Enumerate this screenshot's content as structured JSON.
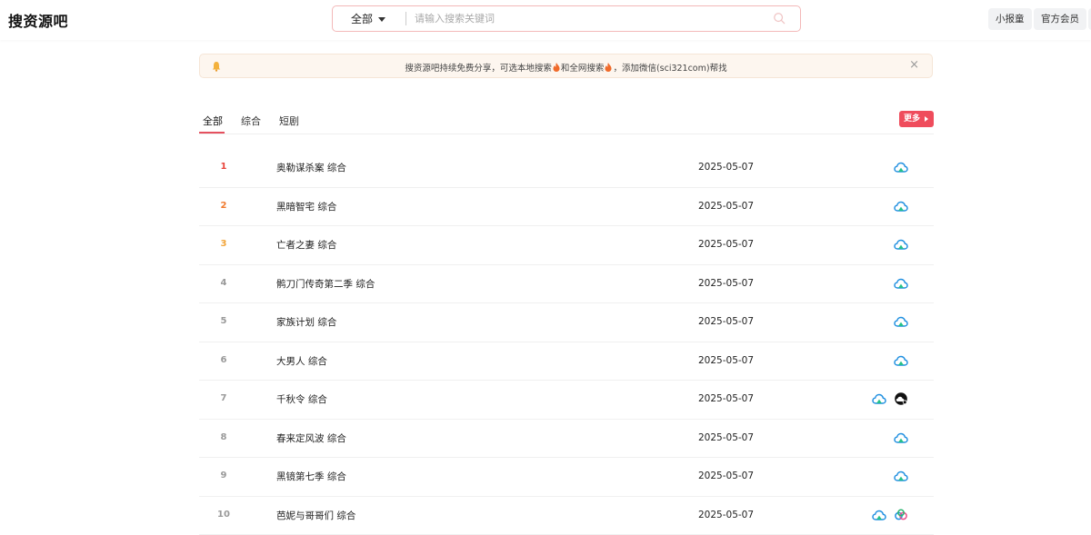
{
  "header": {
    "logo": "搜资源吧",
    "search_type": "全部",
    "search_placeholder": "请输入搜索关键词",
    "buttons": [
      "小报童",
      "官方会员"
    ]
  },
  "notice": {
    "text_before": "搜资源吧持续免费分享，可选本地搜索",
    "text_middle": "和全网搜索",
    "text_after": "，添加微信(sci321com)帮找"
  },
  "tabs": {
    "items": [
      "全部",
      "综合",
      "短剧"
    ],
    "active": 0,
    "more_label": "更多"
  },
  "colors": {
    "accent": "#ef4c5c",
    "rank_1": "#e8453c",
    "rank_2": "#f07a2f",
    "rank_3": "#f2a53a"
  },
  "list": [
    {
      "rank": "1",
      "title": "奥勒谋杀案 综合",
      "date": "2025-05-07",
      "icons": [
        "cloud-icon"
      ]
    },
    {
      "rank": "2",
      "title": "黑暗智宅 综合",
      "date": "2025-05-07",
      "icons": [
        "cloud-icon"
      ]
    },
    {
      "rank": "3",
      "title": "亡者之妻 综合",
      "date": "2025-05-07",
      "icons": [
        "cloud-icon"
      ]
    },
    {
      "rank": "4",
      "title": "鹘刀门传奇第二季 综合",
      "date": "2025-05-07",
      "icons": [
        "cloud-icon"
      ]
    },
    {
      "rank": "5",
      "title": "家族计划 综合",
      "date": "2025-05-07",
      "icons": [
        "cloud-icon"
      ]
    },
    {
      "rank": "6",
      "title": "大男人 综合",
      "date": "2025-05-07",
      "icons": [
        "cloud-icon"
      ]
    },
    {
      "rank": "7",
      "title": "千秋令 综合",
      "date": "2025-05-07",
      "icons": [
        "cloud-icon",
        "black-cloud-icon"
      ]
    },
    {
      "rank": "8",
      "title": "春来定风波 综合",
      "date": "2025-05-07",
      "icons": [
        "cloud-icon"
      ]
    },
    {
      "rank": "9",
      "title": "黑镜第七季 综合",
      "date": "2025-05-07",
      "icons": [
        "cloud-icon"
      ]
    },
    {
      "rank": "10",
      "title": "芭妮与哥哥们 综合",
      "date": "2025-05-07",
      "icons": [
        "cloud-icon",
        "colorful-cloud-icon"
      ]
    }
  ]
}
